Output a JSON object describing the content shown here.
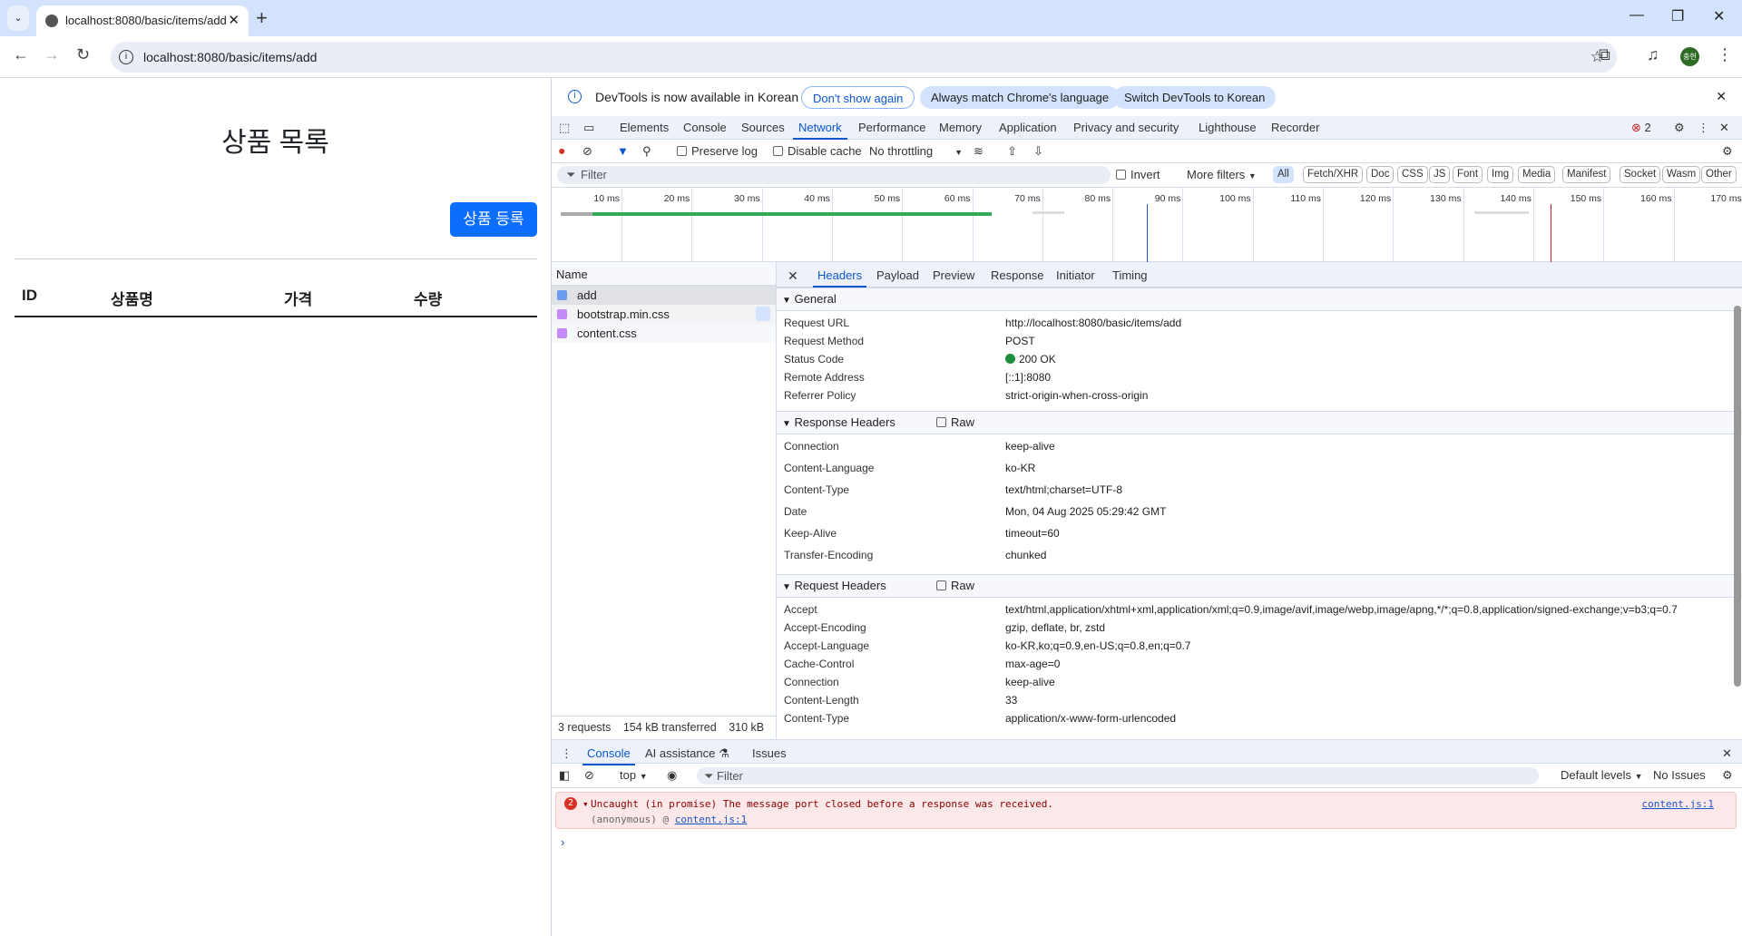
{
  "browser": {
    "tab_title": "localhost:8080/basic/items/add",
    "url": "localhost:8080/basic/items/add",
    "avatar_text": "충헌"
  },
  "page": {
    "title": "상품 목록",
    "add_button": "상품 등록",
    "columns": [
      "ID",
      "상품명",
      "가격",
      "수량"
    ]
  },
  "devtools": {
    "infobar": {
      "message": "DevTools is now available in Korean",
      "btn_dismiss": "Don't show again",
      "btn_match": "Always match Chrome's language",
      "btn_switch": "Switch DevTools to Korean"
    },
    "tabs": [
      "Elements",
      "Console",
      "Sources",
      "Network",
      "Performance",
      "Memory",
      "Application",
      "Privacy and security",
      "Lighthouse",
      "Recorder"
    ],
    "active_tab": "Network",
    "error_count": "2",
    "toolbar": {
      "preserve_log": "Preserve log",
      "disable_cache": "Disable cache",
      "throttling": "No throttling"
    },
    "filter": {
      "placeholder": "Filter",
      "invert": "Invert",
      "more_filters": "More filters",
      "types": [
        "All",
        "Fetch/XHR",
        "Doc",
        "CSS",
        "JS",
        "Font",
        "Img",
        "Media",
        "Manifest",
        "Socket",
        "Wasm",
        "Other"
      ]
    },
    "timeline_ticks": [
      "10 ms",
      "20 ms",
      "30 ms",
      "40 ms",
      "50 ms",
      "60 ms",
      "70 ms",
      "80 ms",
      "90 ms",
      "100 ms",
      "110 ms",
      "120 ms",
      "130 ms",
      "140 ms",
      "150 ms",
      "160 ms",
      "170 ms"
    ],
    "requests": {
      "header": "Name",
      "items": [
        "add",
        "bootstrap.min.css",
        "content.css"
      ],
      "summary": [
        "3 requests",
        "154 kB transferred",
        "310 kB"
      ]
    },
    "detail_tabs": [
      "Headers",
      "Payload",
      "Preview",
      "Response",
      "Initiator",
      "Timing"
    ],
    "general": {
      "title": "General",
      "rows": [
        [
          "Request URL",
          "http://localhost:8080/basic/items/add"
        ],
        [
          "Request Method",
          "POST"
        ],
        [
          "Status Code",
          "200 OK"
        ],
        [
          "Remote Address",
          "[::1]:8080"
        ],
        [
          "Referrer Policy",
          "strict-origin-when-cross-origin"
        ]
      ]
    },
    "response_headers": {
      "title": "Response Headers",
      "raw": "Raw",
      "rows": [
        [
          "Connection",
          "keep-alive"
        ],
        [
          "Content-Language",
          "ko-KR"
        ],
        [
          "Content-Type",
          "text/html;charset=UTF-8"
        ],
        [
          "Date",
          "Mon, 04 Aug 2025 05:29:42 GMT"
        ],
        [
          "Keep-Alive",
          "timeout=60"
        ],
        [
          "Transfer-Encoding",
          "chunked"
        ]
      ]
    },
    "request_headers": {
      "title": "Request Headers",
      "raw": "Raw",
      "rows": [
        [
          "Accept",
          "text/html,application/xhtml+xml,application/xml;q=0.9,image/avif,image/webp,image/apng,*/*;q=0.8,application/signed-exchange;v=b3;q=0.7"
        ],
        [
          "Accept-Encoding",
          "gzip, deflate, br, zstd"
        ],
        [
          "Accept-Language",
          "ko-KR,ko;q=0.9,en-US;q=0.8,en;q=0.7"
        ],
        [
          "Cache-Control",
          "max-age=0"
        ],
        [
          "Connection",
          "keep-alive"
        ],
        [
          "Content-Length",
          "33"
        ],
        [
          "Content-Type",
          "application/x-www-form-urlencoded"
        ]
      ]
    },
    "drawer": {
      "tabs": [
        "Console",
        "AI assistance",
        "Issues"
      ],
      "context": "top",
      "filter": "Filter",
      "levels": "Default levels",
      "issues": "No Issues",
      "error": {
        "count": "2",
        "message": "Uncaught (in promise) The message port closed before a response was received.",
        "source": "content.js:1",
        "stack_prefix": "(anonymous) @",
        "stack_link": "content.js:1"
      }
    }
  }
}
